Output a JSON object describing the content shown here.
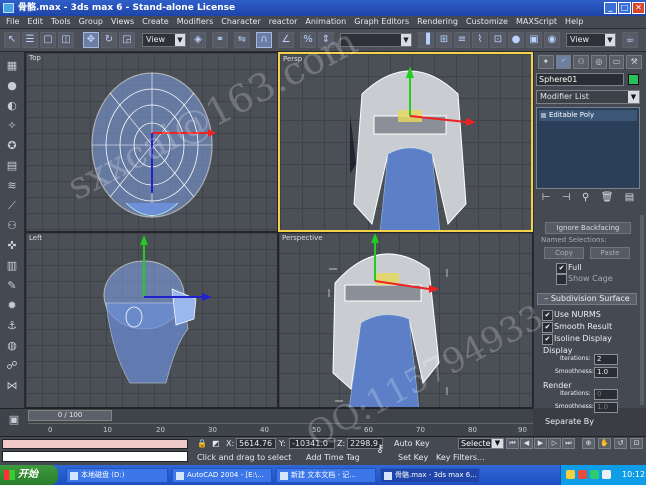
{
  "window": {
    "title": "骨骼.max - 3ds max 6 - Stand-alone License",
    "minimize": "_",
    "maximize": "□",
    "close": "✕"
  },
  "menu": [
    "File",
    "Edit",
    "Tools",
    "Group",
    "Views",
    "Create",
    "Modifiers",
    "Character",
    "reactor",
    "Animation",
    "Graph Editors",
    "Rendering",
    "Customize",
    "MAXScript",
    "Help"
  ],
  "toolbar": {
    "ref_coord": "View",
    "named_sel": "",
    "view_combo": "View"
  },
  "viewports": {
    "top": {
      "label": "Top"
    },
    "persp": {
      "label": "Persp"
    },
    "left": {
      "label": "Left"
    },
    "perspective": {
      "label": "Perspective"
    }
  },
  "command_panel": {
    "object_name": "Sphere01",
    "object_color": "#27c05a",
    "modifier_list": "Modifier List",
    "stack_item": "Editable Poly",
    "selection_rollout": "Ignore Backfacing",
    "named_selections": "Named Selections:",
    "copy_button": "Copy",
    "paste_button": "Paste",
    "full": "Full",
    "show_cage": "Show Cage",
    "subdivision_surface": "Subdivision Surface",
    "use_nurms": "Use NURMS",
    "smooth_result": "Smooth Result",
    "isoline_display": "Isoline Display",
    "display": "Display",
    "iterations_label": "Iterations:",
    "display_iterations": "2",
    "smoothness_label": "Smoothness:",
    "display_smoothness": "1.0",
    "render": "Render",
    "render_iterations": "0",
    "render_smoothness": "1.0",
    "separate_by": "Separate By"
  },
  "timeline": {
    "slider": "0 / 100",
    "ticks": [
      "0",
      "10",
      "20",
      "30",
      "40",
      "50",
      "60",
      "70",
      "80",
      "90"
    ]
  },
  "status": {
    "x_label": "X:",
    "x_value": "5614.76",
    "y_label": "Y:",
    "y_value": "-10341.0",
    "z_label": "Z:",
    "z_value": "2298.9",
    "prompt": "Click and drag to select",
    "add_time_tag": "Add Time Tag",
    "auto_key": "Auto Key",
    "selected": "Selected",
    "set_key": "Set Key",
    "key_filters": "Key Filters..."
  },
  "taskbar": {
    "start": "开始",
    "tasks": [
      "本地磁盘 (D:)",
      "AutoCAD 2004 - [E:\\...",
      "新建 文本文档 - 记...",
      "骨骼.max - 3ds max 6..."
    ],
    "clock": "10:12"
  },
  "watermark": {
    "line1": "sxxcai@163.com",
    "line2": "QQ:115794933"
  }
}
